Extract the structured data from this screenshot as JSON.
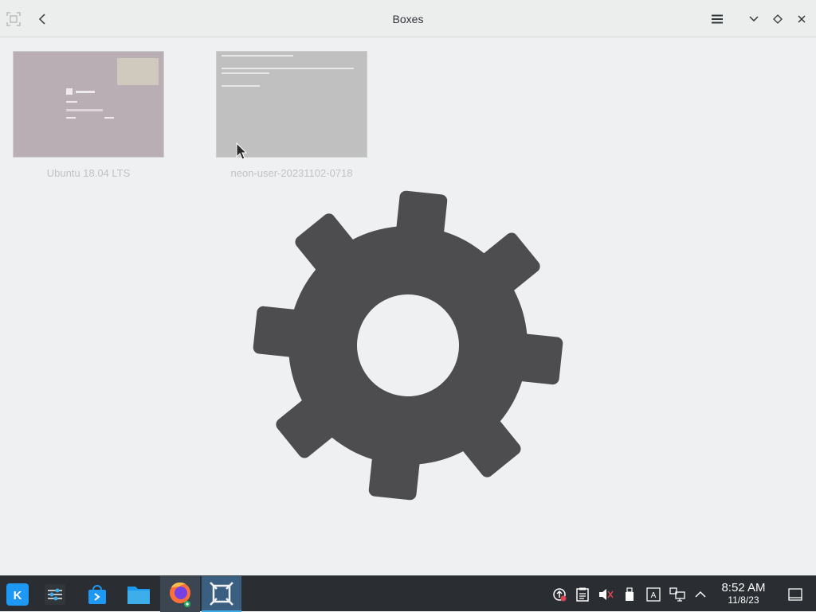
{
  "window": {
    "title": "Boxes"
  },
  "header": {
    "icons": [
      "select-icon",
      "back-icon",
      "menu-icon",
      "minimize-icon",
      "maximize-icon",
      "close-icon"
    ]
  },
  "boxes": [
    {
      "name": "Ubuntu 18.04 LTS"
    },
    {
      "name": "neon-user-20231102-0718"
    }
  ],
  "overlay": {
    "icon": "gear-icon",
    "color": "#4d4d4f"
  },
  "taskbar": {
    "apps": [
      "kde-launcher-icon",
      "system-settings-icon",
      "discover-icon",
      "dolphin-icon",
      "firefox-icon",
      "boxes-icon"
    ],
    "tray": [
      "updates-icon",
      "clipboard-icon",
      "volume-muted-icon",
      "usb-device-icon",
      "keyboard-layout-icon",
      "network-icon",
      "tray-expand-icon"
    ],
    "time": "8:52 AM",
    "date": "11/8/23"
  },
  "colors": {
    "accent": "#3daee9",
    "taskbar_bg": "#2a2e32",
    "window_bg": "#eff0f1"
  }
}
